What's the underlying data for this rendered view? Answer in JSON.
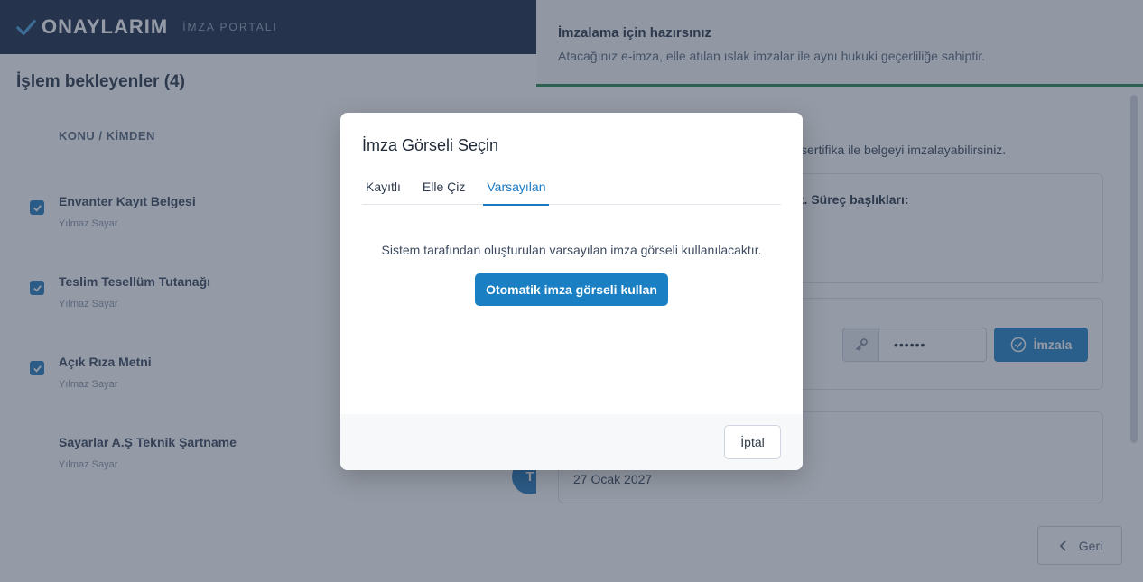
{
  "header": {
    "logo_text": "ONAYLARIM",
    "logo_sub": "İMZA PORTALI"
  },
  "left": {
    "title": "İşlem bekleyenler (4)",
    "column_header": "KONU / KİMDEN",
    "documents": [
      {
        "title": "Envanter Kayıt Belgesi",
        "sender": "Yılmaz Sayar",
        "checked": true
      },
      {
        "title": "Teslim Tesellüm Tutanağı",
        "sender": "Yılmaz Sayar",
        "checked": true
      },
      {
        "title": "Açık Rıza Metni",
        "sender": "Yılmaz Sayar",
        "checked": true
      },
      {
        "title": "Sayarlar A.Ş Teknik Şartname",
        "sender": "Yılmaz Sayar",
        "checked": false
      }
    ],
    "round_button_label": "T"
  },
  "right": {
    "title": "İmzalama için hazırsınız",
    "subtitle": "Atacağınız e-imza, elle atılan ıslak imzalar ile aynı hukuki geçerliliğe sahiptir.",
    "partial_text": "i sertifika ile belgeyi imzalayabilirsiniz.",
    "card1_heading": "uz. Süreç başlıkları:",
    "password_value": "••••••",
    "sign_button": "İmzala",
    "card3_date": "27 Ocak 2027",
    "back_button": "Geri"
  },
  "modal": {
    "title": "İmza Görseli Seçin",
    "tabs": [
      {
        "label": "Kayıtlı",
        "active": false
      },
      {
        "label": "Elle Çiz",
        "active": false
      },
      {
        "label": "Varsayılan",
        "active": true
      }
    ],
    "message": "Sistem tarafından oluşturulan varsayılan imza görseli kullanılacaktır.",
    "primary_button": "Otomatik imza görseli kullan",
    "cancel_button": "İptal"
  },
  "colors": {
    "accent": "#1b80c3",
    "success_line": "#2e8b57",
    "header_bg": "#1f2f4d"
  }
}
